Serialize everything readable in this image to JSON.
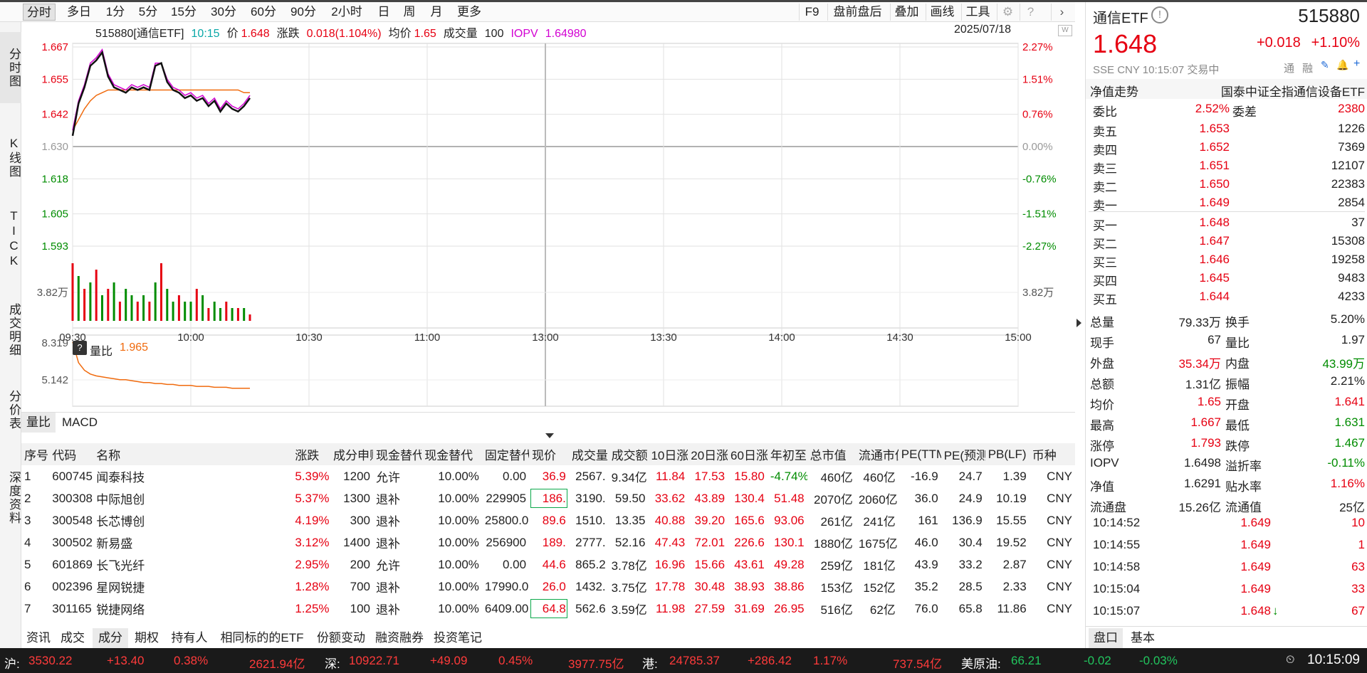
{
  "toolbar": {
    "tabs": [
      "分时",
      "多日",
      "1分",
      "5分",
      "15分",
      "30分",
      "60分",
      "90分",
      "2小时",
      "日",
      "周",
      "月",
      "更多"
    ],
    "right_buttons": [
      "F9",
      "盘前盘后",
      "叠加",
      "画线",
      "工具"
    ]
  },
  "sidenav": [
    "分时图",
    "K线图",
    "TICK",
    "成交明细",
    "分价表",
    "深度资料"
  ],
  "chart_info": {
    "code_name": "515880[通信ETF]",
    "time": "10:15",
    "price_label": "价",
    "price": "1.648",
    "change_label": "涨跌",
    "change": "0.018(1.104%)",
    "avg_label": "均价",
    "avg": "1.65",
    "volume_label": "成交量",
    "volume": "100",
    "iopv_label": "IOPV",
    "iopv": "1.64980",
    "date": "2025/07/18"
  },
  "chart_data": {
    "type": "line",
    "title": "",
    "y_left_ticks": [
      "1.667",
      "1.655",
      "1.642",
      "1.630",
      "1.618",
      "1.605",
      "1.593"
    ],
    "y_right_ticks": [
      "2.27%",
      "1.51%",
      "0.76%",
      "0.00%",
      "-0.76%",
      "-1.51%",
      "-2.27%"
    ],
    "prev_close": 1.63,
    "ylim": [
      1.593,
      1.667
    ],
    "x_ticks": [
      "09:30",
      "10:00",
      "10:30",
      "11:00",
      "13:00",
      "13:30",
      "14:00",
      "14:30",
      "15:00"
    ],
    "volume_tick": "3.82万",
    "series": [
      {
        "name": "价",
        "color": "#111111",
        "values": [
          1.634,
          1.646,
          1.652,
          1.66,
          1.662,
          1.665,
          1.656,
          1.652,
          1.651,
          1.65,
          1.652,
          1.651,
          1.652,
          1.651,
          1.66,
          1.661,
          1.654,
          1.651,
          1.65,
          1.648,
          1.649,
          1.647,
          1.648,
          1.645,
          1.647,
          1.643,
          1.646,
          1.644,
          1.643,
          1.645,
          1.648
        ]
      },
      {
        "name": "IOPV",
        "color": "#d200d2",
        "values": [
          1.636,
          1.647,
          1.653,
          1.661,
          1.663,
          1.666,
          1.657,
          1.653,
          1.652,
          1.651,
          1.653,
          1.652,
          1.653,
          1.652,
          1.661,
          1.661,
          1.655,
          1.652,
          1.651,
          1.649,
          1.65,
          1.648,
          1.649,
          1.646,
          1.648,
          1.644,
          1.647,
          1.645,
          1.644,
          1.646,
          1.649
        ]
      },
      {
        "name": "均价",
        "color": "#f06a0d",
        "values": [
          1.636,
          1.64,
          1.644,
          1.647,
          1.649,
          1.65,
          1.651,
          1.651,
          1.651,
          1.651,
          1.651,
          1.651,
          1.651,
          1.651,
          1.651,
          1.651,
          1.651,
          1.651,
          1.651,
          1.651,
          1.651,
          1.651,
          1.651,
          1.651,
          1.651,
          1.651,
          1.651,
          1.651,
          1.651,
          1.65,
          1.65
        ]
      }
    ],
    "volume_values": [
      0.9,
      0.7,
      0.5,
      0.6,
      0.8,
      0.4,
      0.5,
      0.6,
      0.3,
      0.5,
      0.4,
      0.3,
      0.4,
      0.3,
      0.6,
      0.9,
      0.5,
      0.3,
      0.4,
      0.3,
      0.3,
      0.5,
      0.4,
      0.2,
      0.3,
      0.2,
      0.3,
      0.2,
      0.2,
      0.2,
      0.1
    ],
    "volume_colors": [
      "r",
      "g",
      "r",
      "g",
      "r",
      "g",
      "r",
      "g",
      "r",
      "g",
      "g",
      "r",
      "g",
      "r",
      "g",
      "r",
      "g",
      "g",
      "r",
      "g",
      "g",
      "r",
      "g",
      "r",
      "g",
      "g",
      "r",
      "g",
      "r",
      "g",
      "r"
    ],
    "ratio_ticks": [
      "8.319",
      "5.142"
    ],
    "ratio_label": "量比",
    "ratio_value": "1.965",
    "ratio_values": [
      8.2,
      6.0,
      5.2,
      4.8,
      4.6,
      4.5,
      4.4,
      4.3,
      4.2,
      4.2,
      4.1,
      4.0,
      3.9,
      3.9,
      3.8,
      3.8,
      3.7,
      3.7,
      3.6,
      3.6,
      3.6,
      3.5,
      3.5,
      3.5,
      3.4,
      3.4,
      3.4,
      3.3,
      3.3,
      3.3,
      3.3
    ]
  },
  "ind_tabs": [
    "量比",
    "MACD"
  ],
  "table": {
    "headers": [
      "序号",
      "代码",
      "名称",
      "涨跌",
      "成分申赎",
      "现金替代",
      "现金替代",
      "固定替代",
      "现价",
      "成交量",
      "成交额",
      "10日涨",
      "20日涨",
      "60日涨",
      "年初至",
      "总市值",
      "流通市值",
      "PE(TTM)",
      "PE(预测)",
      "PB(LF)",
      "币种"
    ],
    "rows": [
      [
        "1",
        "600745",
        "闻泰科技",
        "5.39%",
        "1200",
        "允许",
        "10.00%",
        "0.00",
        "36.9",
        "2567.",
        "9.34亿",
        "11.84",
        "17.53",
        "15.80",
        "-4.74%",
        "460亿",
        "460亿",
        "-16.9",
        "24.7",
        "1.39",
        "CNY"
      ],
      [
        "2",
        "300308",
        "中际旭创",
        "5.37%",
        "1300",
        "退补",
        "10.00%",
        "229905",
        "186.",
        "3190.",
        "59.50",
        "33.62",
        "43.89",
        "130.4",
        "51.48",
        "2070亿",
        "2060亿",
        "36.0",
        "24.9",
        "10.19",
        "CNY"
      ],
      [
        "3",
        "300548",
        "长芯博创",
        "4.19%",
        "300",
        "退补",
        "10.00%",
        "25800.0",
        "89.6",
        "1510.",
        "13.35",
        "40.88",
        "39.20",
        "165.6",
        "93.06",
        "261亿",
        "241亿",
        "161",
        "136.9",
        "15.55",
        "CNY"
      ],
      [
        "4",
        "300502",
        "新易盛",
        "3.12%",
        "1400",
        "退补",
        "10.00%",
        "256900",
        "189.",
        "2777.",
        "52.16",
        "47.43",
        "72.01",
        "226.6",
        "130.1",
        "1880亿",
        "1675亿",
        "46.0",
        "30.4",
        "19.52",
        "CNY"
      ],
      [
        "5",
        "601869",
        "长飞光纤",
        "2.95%",
        "200",
        "允许",
        "10.00%",
        "0.00",
        "44.6",
        "865.2",
        "3.78亿",
        "16.96",
        "15.66",
        "43.61",
        "49.28",
        "259亿",
        "181亿",
        "43.9",
        "33.2",
        "2.87",
        "CNY"
      ],
      [
        "6",
        "002396",
        "星网锐捷",
        "1.28%",
        "700",
        "退补",
        "10.00%",
        "17990.0",
        "26.0",
        "1432.",
        "3.75亿",
        "17.78",
        "30.48",
        "38.93",
        "38.86",
        "153亿",
        "152亿",
        "35.2",
        "28.5",
        "2.33",
        "CNY"
      ],
      [
        "7",
        "301165",
        "锐捷网络",
        "1.25%",
        "100",
        "退补",
        "10.00%",
        "6409.00",
        "64.8",
        "562.6",
        "3.59亿",
        "11.98",
        "27.59",
        "31.69",
        "26.95",
        "516亿",
        "62亿",
        "76.0",
        "65.8",
        "11.86",
        "CNY"
      ]
    ]
  },
  "bottom_tabs": [
    "资讯",
    "成交",
    "成分",
    "期权",
    "持有人",
    "相同标的的ETF",
    "份额变动",
    "融资融券",
    "投资笔记"
  ],
  "quote": {
    "name": "通信ETF",
    "code": "515880",
    "price": "1.648",
    "change": "+0.018",
    "pct": "+1.10%",
    "exch": "SSE",
    "currency": "CNY",
    "time": "10:15:07",
    "state": "交易中",
    "tags": [
      "通",
      "融"
    ],
    "nav_trend_label": "净值走势",
    "fund_full": "国泰中证全指通信设备ETF",
    "weibi_label": "委比",
    "weibi": "2.52%",
    "weicha_label": "委差",
    "weicha": "2380",
    "asks": [
      [
        "卖五",
        "1.653",
        "1226"
      ],
      [
        "卖四",
        "1.652",
        "7369"
      ],
      [
        "卖三",
        "1.651",
        "12107"
      ],
      [
        "卖二",
        "1.650",
        "22383"
      ],
      [
        "卖一",
        "1.649",
        "2854"
      ]
    ],
    "bids": [
      [
        "买一",
        "1.648",
        "37"
      ],
      [
        "买二",
        "1.647",
        "15308"
      ],
      [
        "买三",
        "1.646",
        "19258"
      ],
      [
        "买四",
        "1.645",
        "9483"
      ],
      [
        "买五",
        "1.644",
        "4233"
      ]
    ],
    "stats": [
      [
        "总量",
        "79.33万",
        "换手",
        "5.20%"
      ],
      [
        "现手",
        "67",
        "量比",
        "1.97"
      ],
      [
        "外盘",
        "35.34万",
        "内盘",
        "43.99万"
      ],
      [
        "总额",
        "1.31亿",
        "振幅",
        "2.21%"
      ],
      [
        "均价",
        "1.65",
        "开盘",
        "1.641"
      ],
      [
        "最高",
        "1.667",
        "最低",
        "1.631"
      ],
      [
        "涨停",
        "1.793",
        "跌停",
        "1.467"
      ]
    ],
    "stats2": [
      [
        "IOPV",
        "1.6498",
        "溢折率",
        "-0.11%"
      ],
      [
        "净值",
        "1.6291",
        "贴水率",
        "1.16%"
      ],
      [
        "流通盘",
        "15.26亿",
        "流通值",
        "25亿"
      ]
    ],
    "ticks": [
      [
        "10:14:52",
        "1.649",
        "10"
      ],
      [
        "10:14:55",
        "1.649",
        "1"
      ],
      [
        "10:14:58",
        "1.649",
        "63"
      ],
      [
        "10:15:04",
        "1.649",
        "33"
      ],
      [
        "10:15:07",
        "1.648",
        "67"
      ]
    ],
    "bottom_tabs": [
      "盘口",
      "基本"
    ]
  },
  "statusbar": {
    "sh_label": "沪:",
    "sh": "3530.22",
    "sh_chg": "+13.40",
    "sh_pct": "0.38%",
    "sh_amt": "2621.94亿",
    "sz_label": "深:",
    "sz": "10922.71",
    "sz_chg": "+49.09",
    "sz_pct": "0.45%",
    "sz_amt": "3977.75亿",
    "hk_label": "港:",
    "hk": "24785.37",
    "hk_chg": "+286.42",
    "hk_pct": "1.17%",
    "hk_amt": "737.54亿",
    "oil_label": "美原油:",
    "oil": "66.21",
    "oil_chg": "-0.02",
    "oil_pct": "-0.03%",
    "clock": "10:15:09"
  }
}
